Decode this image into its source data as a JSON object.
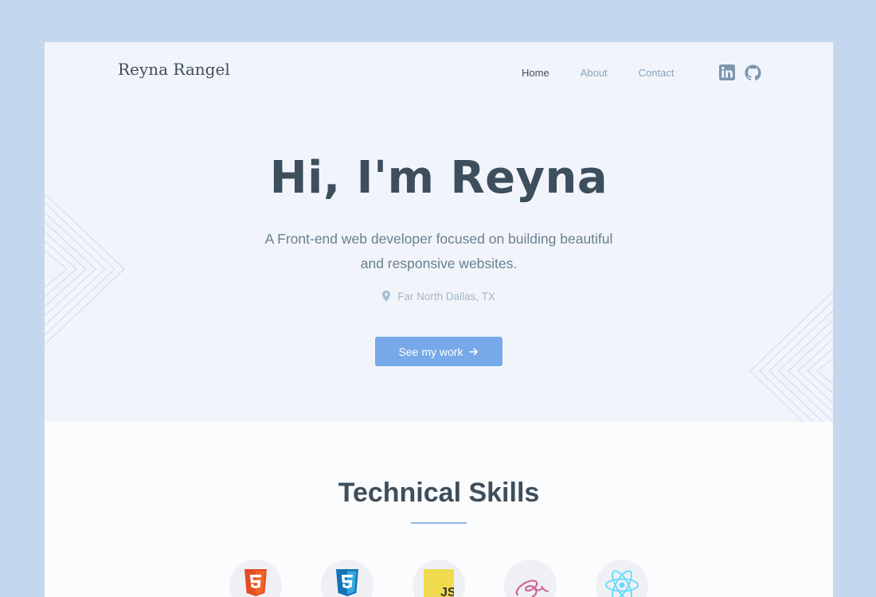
{
  "brand": "Reyna Rangel",
  "nav": {
    "home": "Home",
    "about": "About",
    "contact": "Contact"
  },
  "social": [
    "linkedin-icon",
    "github-icon"
  ],
  "hero": {
    "title": "Hi, I'm Reyna",
    "subtitle": "A Front-end web developer focused on building beautiful and responsive websites.",
    "location": "Far North Dallas, TX",
    "cta": "See my work"
  },
  "skills": {
    "title": "Technical Skills",
    "icons": [
      "html5-icon",
      "css3-icon",
      "javascript-icon",
      "sass-icon",
      "react-icon"
    ]
  },
  "colors": {
    "backdrop": "#c3d8ee",
    "hero_bg": "#f1f5fb",
    "accent": "#77a9ea",
    "text_dark": "#3d4e5c",
    "text_muted": "#6b7e90"
  }
}
